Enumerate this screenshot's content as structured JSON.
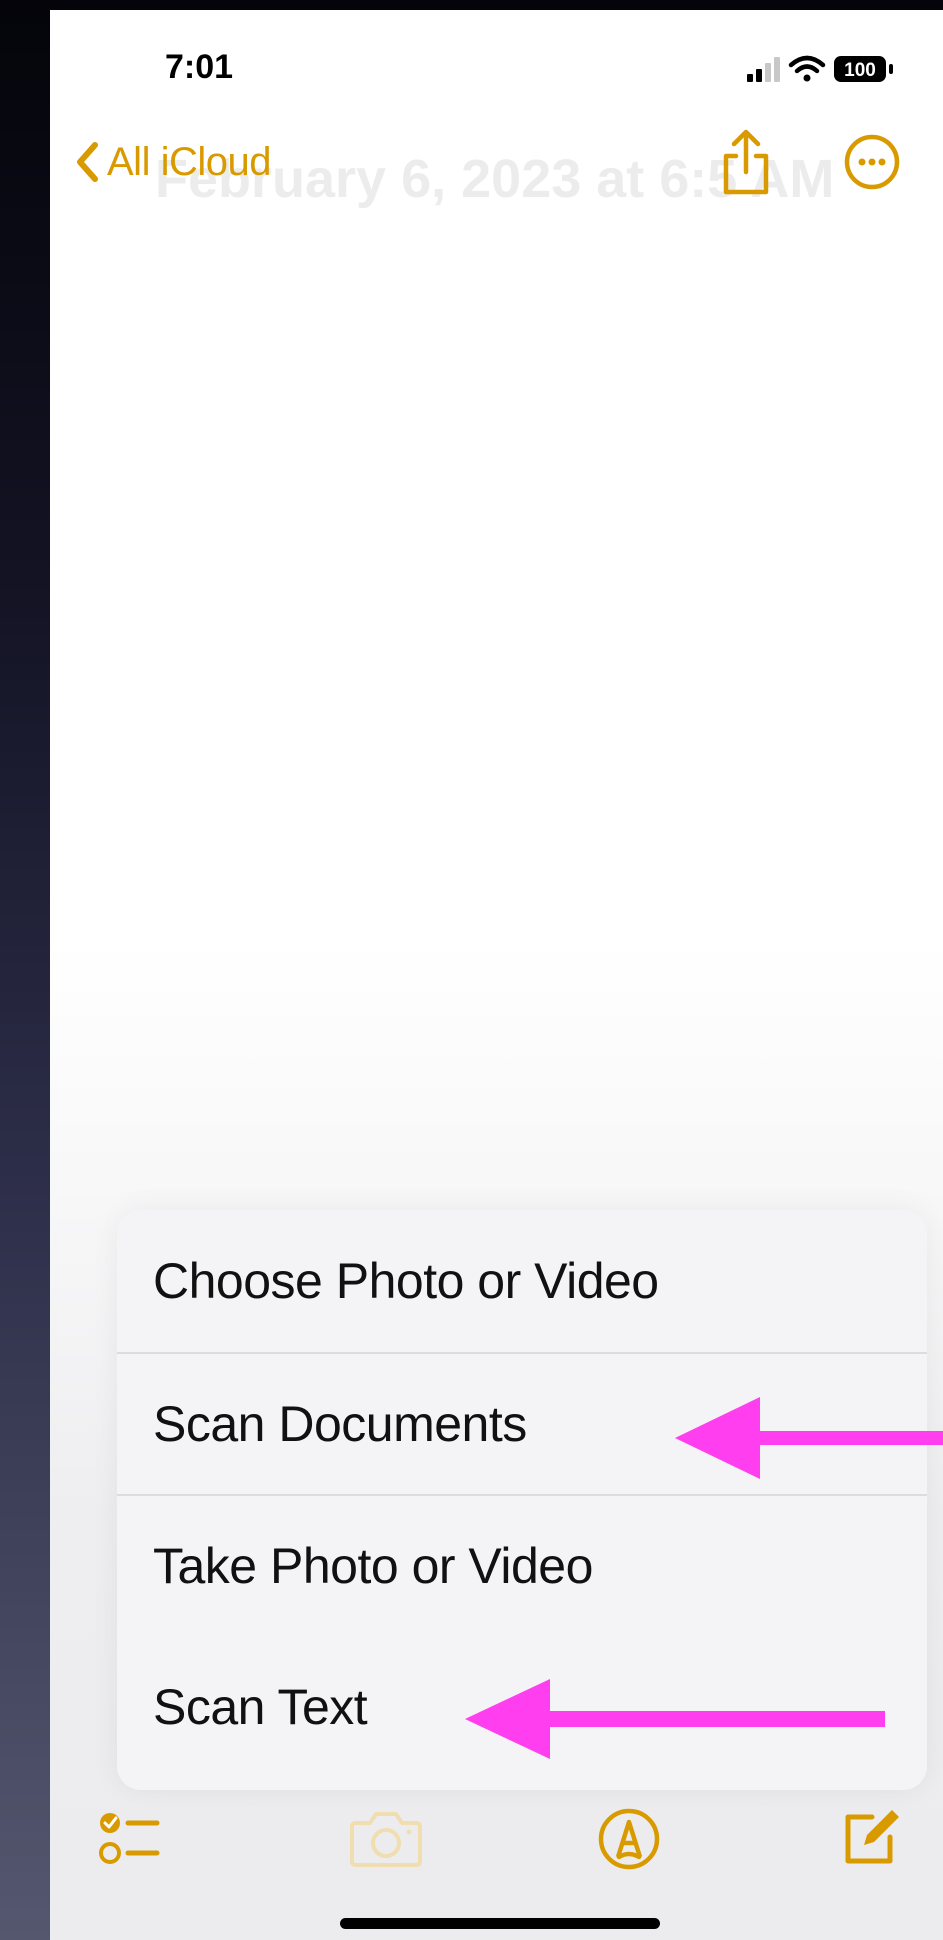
{
  "status_bar": {
    "time": "7:01",
    "battery_level": "100"
  },
  "nav": {
    "back_label": "All iCloud",
    "note_date_title": "February 6, 2023 at 6:5 AM"
  },
  "menu": {
    "items": [
      {
        "label": "Choose Photo or Video"
      },
      {
        "label": "Scan Documents"
      },
      {
        "label": "Take Photo or Video"
      },
      {
        "label": "Scan Text"
      }
    ]
  },
  "toolbar": {
    "items": [
      "checklist-icon",
      "camera-icon",
      "markup-icon",
      "compose-icon"
    ]
  },
  "colors": {
    "accent": "#d99a00",
    "arrow": "#ff3ef0"
  }
}
